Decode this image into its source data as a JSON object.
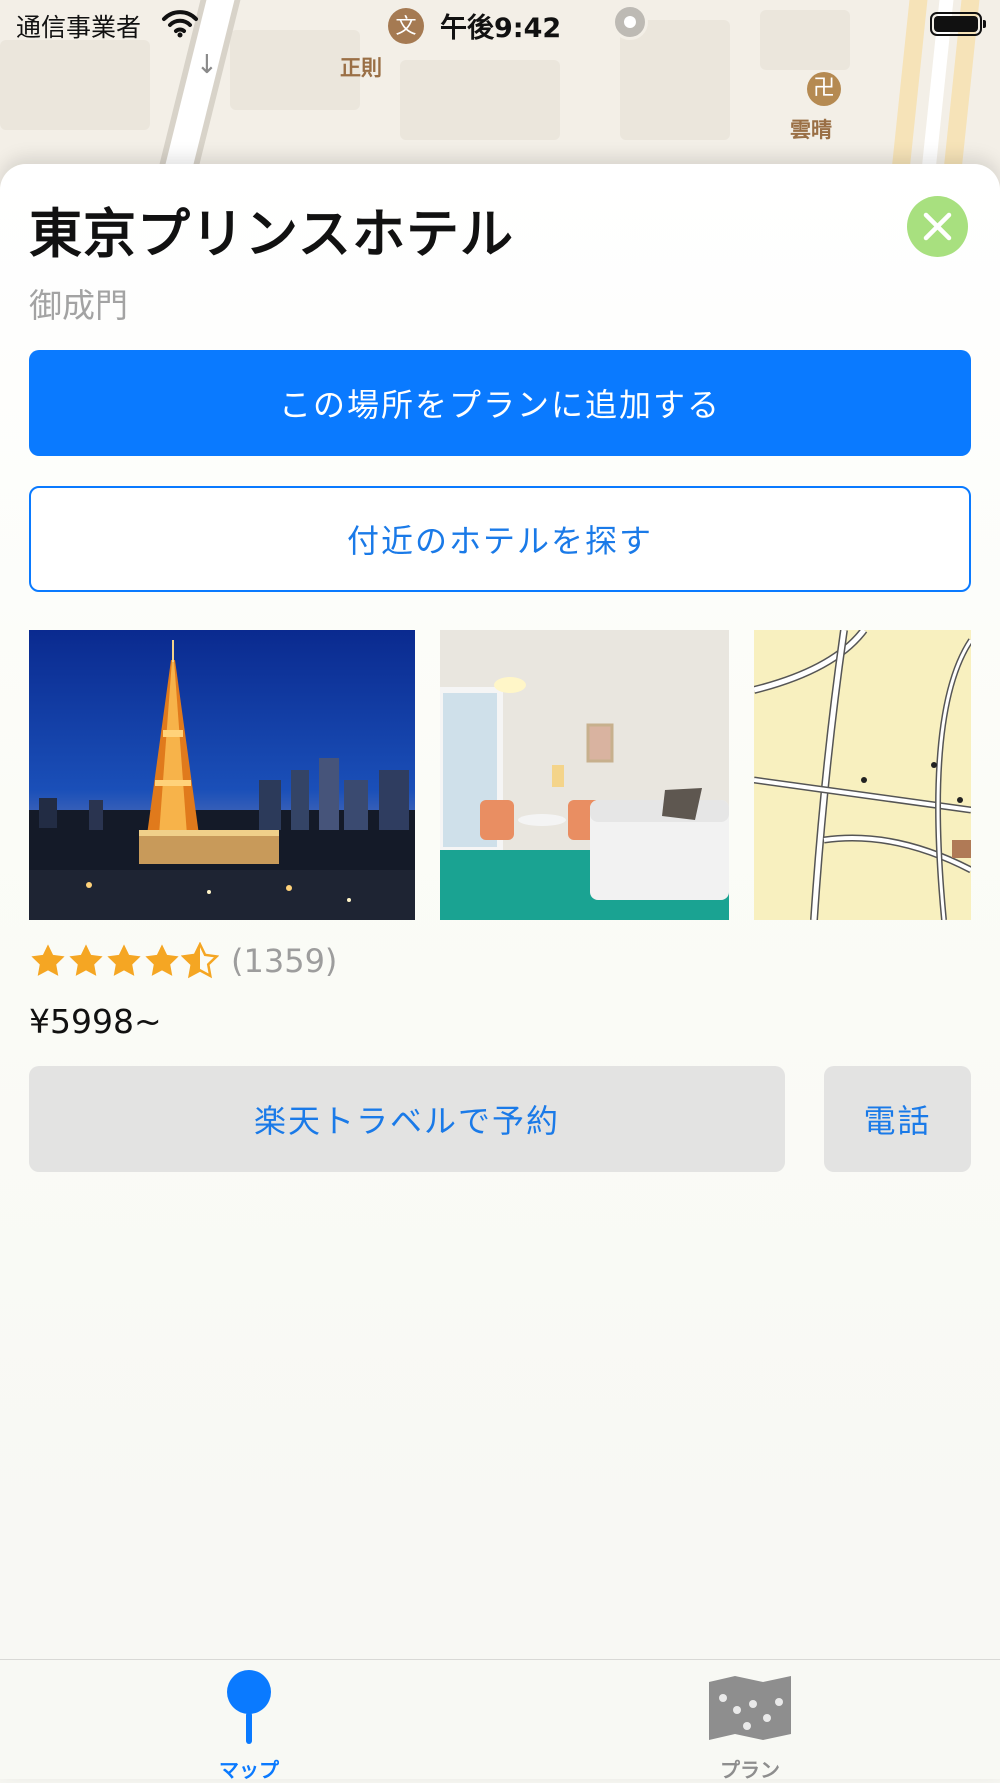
{
  "status_bar": {
    "carrier": "通信事業者",
    "time": "午後9:42",
    "moji": "文"
  },
  "map": {
    "label_left": "正則",
    "label_right": "雲晴",
    "temple_glyph": "卍"
  },
  "place": {
    "name": "東京プリンスホテル",
    "area": "御成門"
  },
  "actions": {
    "add_to_plan": "この場所をプランに追加する",
    "find_nearby_hotels": "付近のホテルを探す",
    "book_rakuten": "楽天トラベルで予約",
    "call": "電話"
  },
  "rating": {
    "value": 4.5,
    "max": 5,
    "count_text": "(1359)"
  },
  "price": "¥5998~",
  "photos": [
    {
      "name": "tokyo-tower-night-photo"
    },
    {
      "name": "hotel-room-photo"
    },
    {
      "name": "access-map-photo"
    }
  ],
  "tabbar": {
    "tabs": [
      {
        "label": "マップ",
        "active": true
      },
      {
        "label": "プラン",
        "active": false
      }
    ]
  },
  "colors": {
    "accent": "#0a7aff",
    "close": "#a8e07f",
    "star": "#f5a623",
    "tab_active": "#0a7aff",
    "tab_inactive": "#8e8e8e"
  }
}
